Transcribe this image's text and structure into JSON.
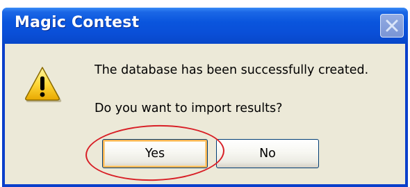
{
  "dialog": {
    "title": "Magic Contest",
    "close_icon": "close-icon",
    "icon": "warning-icon",
    "message_line1": "The database has been successfully created.",
    "message_line2": "Do you want to import results?",
    "buttons": {
      "yes_label": "Yes",
      "no_label": "No"
    },
    "annotation": {
      "type": "red-circle-highlight",
      "target": "yes-button",
      "color": "#d81f26"
    }
  },
  "colors": {
    "titlebar": "#0a55dd",
    "client_background": "#ece9d8",
    "default_button_focus": "#f8b654"
  }
}
